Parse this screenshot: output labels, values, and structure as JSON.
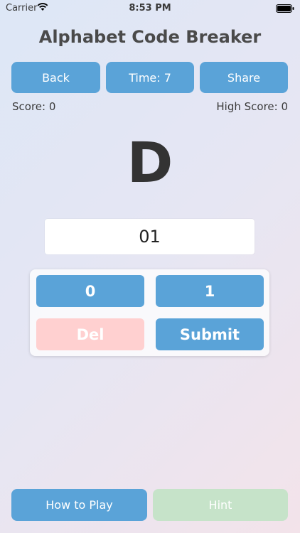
{
  "status_bar": {
    "carrier": "Carrier",
    "time": "8:53 PM"
  },
  "app": {
    "title": "Alphabet Code Breaker"
  },
  "toolbar": {
    "back_label": "Back",
    "time_label": "Time: 7",
    "share_label": "Share"
  },
  "scores": {
    "score_label": "Score: 0",
    "high_score_label": "High Score: 0"
  },
  "game": {
    "letter": "D",
    "answer_value": "01"
  },
  "keypad": {
    "zero": "0",
    "one": "1",
    "del": "Del",
    "submit": "Submit"
  },
  "footer": {
    "how_to_play": "How to Play",
    "hint": "Hint"
  },
  "colors": {
    "accent": "#5aa3d8",
    "del_disabled": "#ffd0d0",
    "hint_disabled": "#c6e3c9"
  },
  "icons": {
    "wifi": "wifi-icon",
    "battery": "battery-icon"
  }
}
